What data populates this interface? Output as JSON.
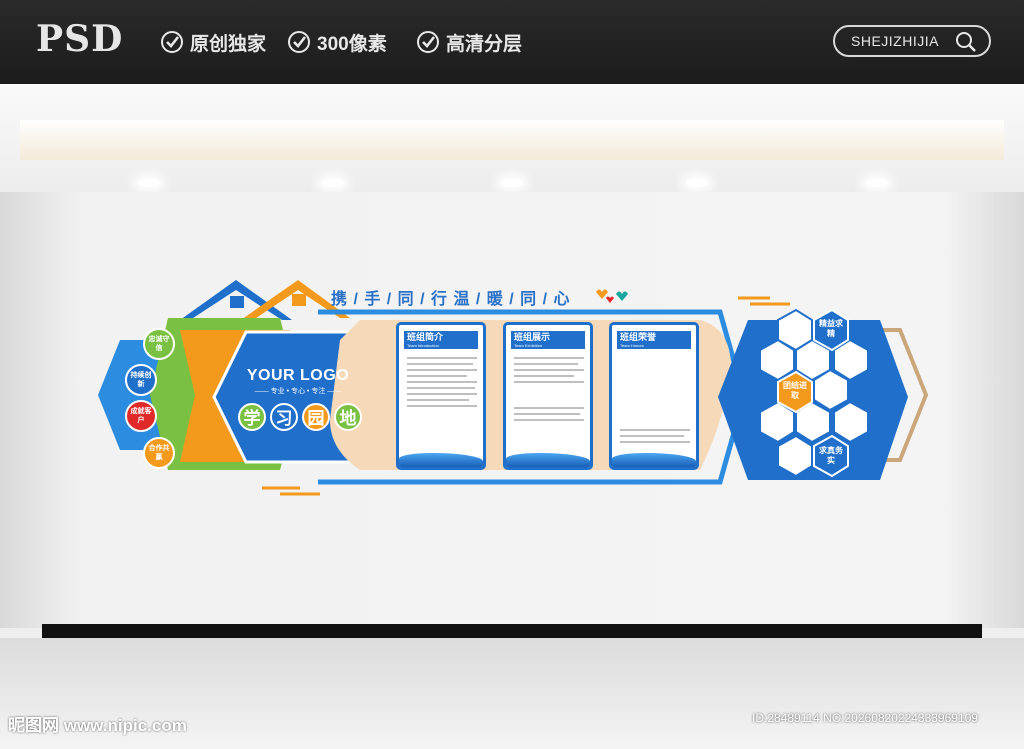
{
  "header": {
    "brand": "PSD",
    "features": [
      "原创独家",
      "300像素",
      "高清分层"
    ],
    "search_text": "SHEJIZHIJIA"
  },
  "mural": {
    "slogan": "携 / 手 / 同 / 行  温 / 暖 / 同 / 心",
    "logo_title": "YOUR LOGO",
    "logo_sub": "—— 专业 • 专心 • 专注 ——",
    "study_chars": [
      "学",
      "习",
      "园",
      "地"
    ],
    "side_labels": [
      "忠诚守信",
      "持续创新",
      "成就客户",
      "合作共赢"
    ],
    "panels": [
      {
        "title": "班组简介",
        "subtitle": "Team Introduction"
      },
      {
        "title": "班组展示",
        "subtitle": "Team Exhibition"
      },
      {
        "title": "班组荣誉",
        "subtitle": "Team Honors"
      }
    ],
    "hex_labels": [
      "精益求精",
      "团结进取",
      "求真务实"
    ]
  },
  "footer": {
    "watermark": "昵图网 www.nipic.com",
    "id_text": "ID:28489114 NO:20260820224333969109"
  },
  "colors": {
    "blue": "#1f6fcb",
    "orange": "#f39a1d",
    "green": "#7ac143",
    "red": "#e02a2a",
    "peach": "#f6d9b8"
  }
}
